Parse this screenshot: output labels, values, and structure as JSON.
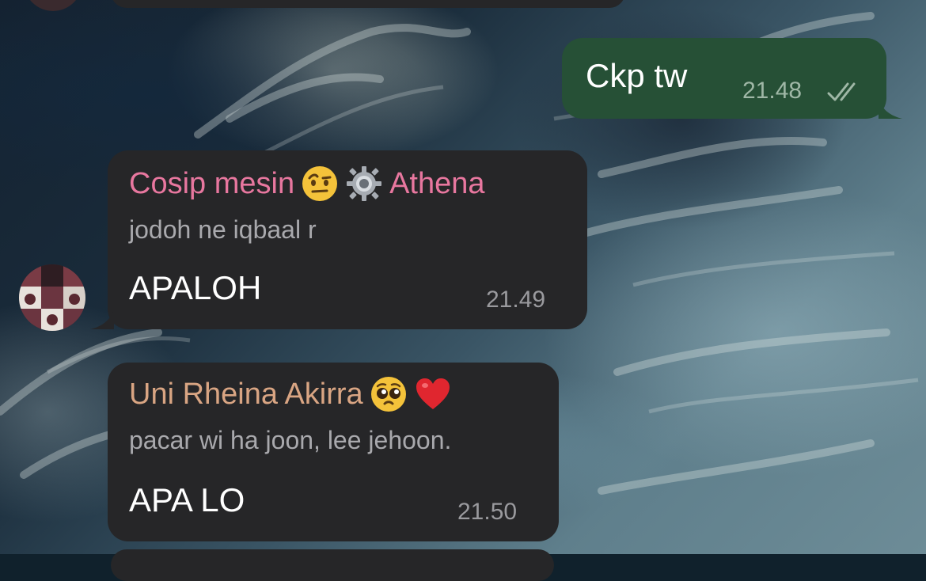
{
  "messages": [
    {
      "direction": "outgoing",
      "text": "Ckp tw",
      "time": "21.48",
      "status_icon": "double-check-icon"
    },
    {
      "direction": "incoming",
      "sender": "Cosip mesin",
      "sender_suffix": "Athena",
      "sender_emojis": [
        "raised-eyebrow-emoji",
        "gear-emoji"
      ],
      "sender_color": "#e8779f",
      "reply_quote": "jodoh ne iqbaal r",
      "text": "APALOH",
      "time": "21.49"
    },
    {
      "direction": "incoming",
      "sender": "Uni Rheina Akirra",
      "sender_emojis": [
        "pleading-face-emoji",
        "red-heart-emoji"
      ],
      "sender_color": "#d9a583",
      "reply_quote": "pacar wi ha joon, lee jehoon.",
      "text": "APA LO",
      "time": "21.50"
    }
  ],
  "colors": {
    "incoming_bubble": "#262628",
    "outgoing_bubble": "#265036",
    "timestamp": "#9a9a9e"
  }
}
